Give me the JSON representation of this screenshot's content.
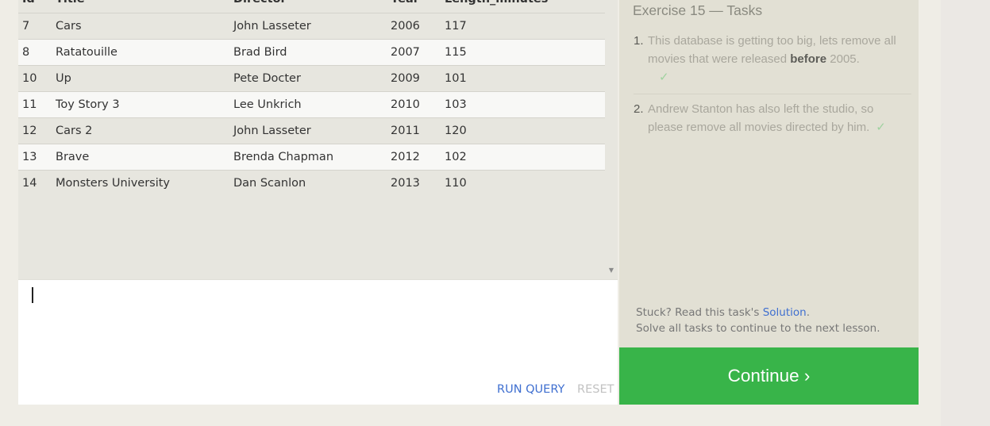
{
  "results": {
    "columns": [
      "Id",
      "Title",
      "Director",
      "Year",
      "Length_minutes"
    ],
    "rows": [
      [
        "7",
        "Cars",
        "John Lasseter",
        "2006",
        "117"
      ],
      [
        "8",
        "Ratatouille",
        "Brad Bird",
        "2007",
        "115"
      ],
      [
        "10",
        "Up",
        "Pete Docter",
        "2009",
        "101"
      ],
      [
        "11",
        "Toy Story 3",
        "Lee Unkrich",
        "2010",
        "103"
      ],
      [
        "12",
        "Cars 2",
        "John Lasseter",
        "2011",
        "120"
      ],
      [
        "13",
        "Brave",
        "Brenda Chapman",
        "2012",
        "102"
      ],
      [
        "14",
        "Monsters University",
        "Dan Scanlon",
        "2013",
        "110"
      ]
    ]
  },
  "editor": {
    "value": "",
    "run_label": "RUN QUERY",
    "reset_label": "RESET"
  },
  "tasks": {
    "title": "Exercise 15 — Tasks",
    "items": [
      {
        "num": "1.",
        "text_before": "This database is getting too big, lets remove all movies that were released ",
        "bold": "before",
        "text_after": " 2005.",
        "check": "✓"
      },
      {
        "num": "2.",
        "text": "Andrew Stanton has also left the studio, so please remove all movies directed by him.",
        "check": "✓"
      }
    ],
    "stuck_prefix": "Stuck? Read this task's ",
    "solution_link": "Solution",
    "stuck_suffix": ".",
    "solve_all": "Solve all tasks to continue to the next lesson."
  },
  "continue_label": "Continue ›",
  "colors": {
    "accent_green": "#38b449",
    "link_blue": "#3f6fd0",
    "check_green": "#9fd29f"
  }
}
